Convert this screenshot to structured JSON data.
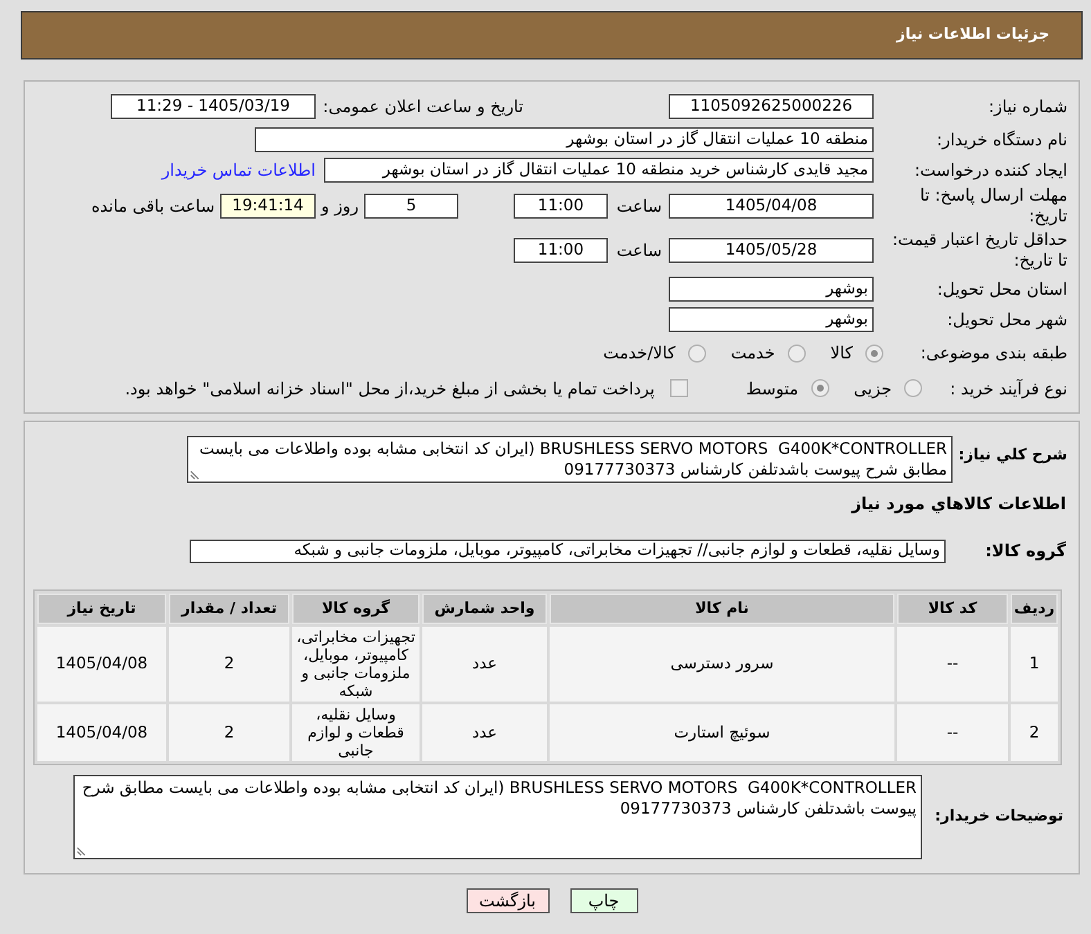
{
  "header": {
    "title": "جزئیات اطلاعات نیاز"
  },
  "details": {
    "need_number": {
      "label": "شماره نیاز:",
      "value": "1105092625000226"
    },
    "announce_datetime": {
      "label": "تاریخ و ساعت اعلان عمومی:",
      "value": "1405/03/19 - 11:29"
    },
    "buyer_org": {
      "label": "نام دستگاه خریدار:",
      "value": "منطقه 10 عملیات انتقال گاز در استان بوشهر"
    },
    "requester": {
      "label": "ایجاد کننده درخواست:",
      "value": "مجید قایدی کارشناس خرید منطقه 10 عملیات انتقال گاز در استان بوشهر",
      "contact_link": "اطلاعات تماس خریدار"
    },
    "reply_deadline": {
      "label": "مهلت ارسال پاسخ: تا تاریخ:",
      "date": "1405/04/08",
      "time_label": "ساعت",
      "time": "11:00",
      "days": "5",
      "days_label": "روز و",
      "remaining": "19:41:14",
      "remaining_label": "ساعت باقی مانده"
    },
    "price_validity": {
      "label": "حداقل تاریخ اعتبار قیمت: تا تاریخ:",
      "date": "1405/05/28",
      "time_label": "ساعت",
      "time": "11:00"
    },
    "delivery_province": {
      "label": "استان محل تحویل:",
      "value": "بوشهر"
    },
    "delivery_city": {
      "label": "شهر محل تحویل:",
      "value": "بوشهر"
    },
    "classification": {
      "label": "طبقه بندی موضوعی:",
      "disabled": true,
      "options": [
        {
          "label": "کالا",
          "selected": true
        },
        {
          "label": "خدمت",
          "selected": false
        },
        {
          "label": "کالا/خدمت",
          "selected": false
        }
      ]
    },
    "purchase_process": {
      "label": "نوع فرآیند خرید :",
      "disabled": true,
      "options": [
        {
          "label": "جزیی",
          "selected": false
        },
        {
          "label": "متوسط",
          "selected": true
        }
      ],
      "treasury_payment": {
        "label": "پرداخت تمام یا بخشی از مبلغ خرید،از محل \"اسناد خزانه اسلامی\" خواهد بود.",
        "checked": false,
        "disabled": true
      }
    }
  },
  "needs": {
    "description": {
      "label": "شرح کلي نیاز:",
      "value": "BRUSHLESS SERVO MOTORS  G400K*CONTROLLER (ایران کد انتخابی مشابه بوده واطلاعات می بایست مطابق شرح پیوست باشدتلفن کارشناس 09177730373"
    },
    "goods_heading": "اطلاعات کالاهاي مورد نیاز",
    "goods_group": {
      "label": "گروه کالا:",
      "value": "وسایل نقلیه، قطعات و لوازم جانبی// تجهیزات مخابراتی، کامپیوتر، موبایل، ملزومات جانبی و شبکه"
    },
    "table": {
      "columns": [
        "ردیف",
        "کد کالا",
        "نام کالا",
        "واحد شمارش",
        "گروه کالا",
        "تعداد / مقدار",
        "تاریخ نیاز"
      ],
      "rows": [
        [
          "1",
          "--",
          "سرور دسترسی",
          "عدد",
          "تجهیزات مخابراتی، کامپیوتر، موبایل، ملزومات جانبی و شبکه",
          "2",
          "1405/04/08"
        ],
        [
          "2",
          "--",
          "سوئیچ استارت",
          "عدد",
          "وسایل نقلیه، قطعات و لوازم جانبی",
          "2",
          "1405/04/08"
        ]
      ]
    },
    "buyer_notes": {
      "label": "توضیحات خریدار:",
      "value": "BRUSHLESS SERVO MOTORS  G400K*CONTROLLER (ایران کد انتخابی مشابه بوده واطلاعات می بایست مطابق شرح پیوست باشدتلفن کارشناس 09177730373"
    }
  },
  "buttons": [
    {
      "label": "چاپ",
      "kind": "print"
    },
    {
      "label": "بازگشت",
      "kind": "back"
    }
  ]
}
